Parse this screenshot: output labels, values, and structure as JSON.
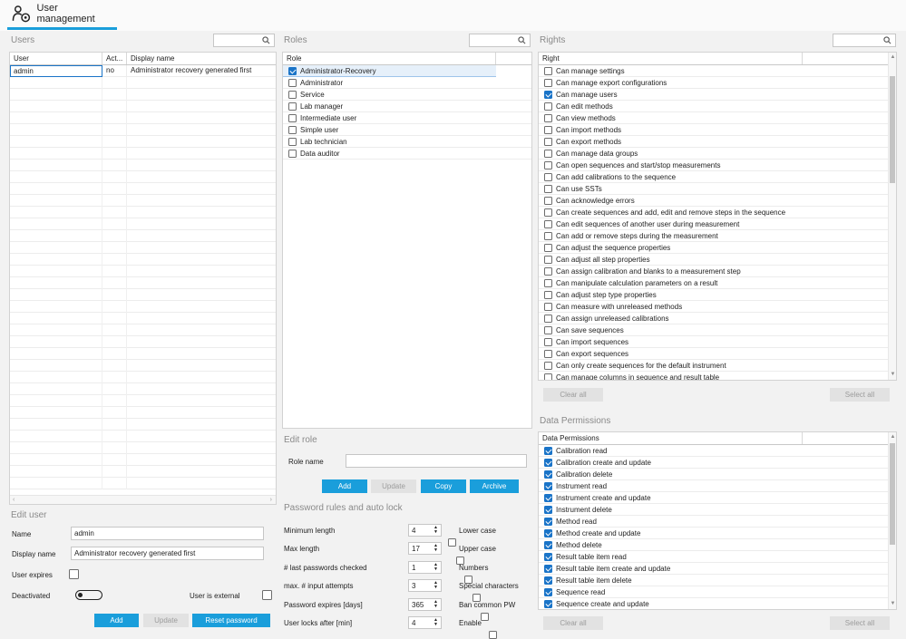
{
  "app": {
    "tab_title": "User management",
    "accent": "#1a9edb"
  },
  "users": {
    "title": "Users",
    "columns": [
      "User",
      "Act...",
      "Display name"
    ],
    "rows": [
      {
        "user": "admin",
        "active": "no",
        "display": "Administrator recovery generated first"
      }
    ]
  },
  "roles": {
    "title": "Roles",
    "column": "Role",
    "items": [
      {
        "label": "Administrator-Recovery",
        "checked": true
      },
      {
        "label": "Administrator",
        "checked": false
      },
      {
        "label": "Service",
        "checked": false
      },
      {
        "label": "Lab manager",
        "checked": false
      },
      {
        "label": "Intermediate user",
        "checked": false
      },
      {
        "label": "Simple user",
        "checked": false
      },
      {
        "label": "Lab technician",
        "checked": false
      },
      {
        "label": "Data auditor",
        "checked": false
      }
    ]
  },
  "rights": {
    "title": "Rights",
    "column": "Right",
    "clear_all": "Clear all",
    "select_all": "Select all",
    "items": [
      {
        "label": "Can manage settings",
        "checked": false
      },
      {
        "label": "Can manage export configurations",
        "checked": false
      },
      {
        "label": "Can manage users",
        "checked": true
      },
      {
        "label": "Can edit methods",
        "checked": false
      },
      {
        "label": "Can view methods",
        "checked": false
      },
      {
        "label": "Can import methods",
        "checked": false
      },
      {
        "label": "Can export methods",
        "checked": false
      },
      {
        "label": "Can manage data groups",
        "checked": false
      },
      {
        "label": "Can open sequences and start/stop measurements",
        "checked": false
      },
      {
        "label": "Can add calibrations to the sequence",
        "checked": false
      },
      {
        "label": "Can use SSTs",
        "checked": false
      },
      {
        "label": "Can acknowledge errors",
        "checked": false
      },
      {
        "label": "Can create sequences and add, edit and remove steps in the sequence",
        "checked": false
      },
      {
        "label": "Can edit sequences of another user during measurement",
        "checked": false
      },
      {
        "label": "Can add or remove steps during the measurement",
        "checked": false
      },
      {
        "label": "Can adjust the sequence properties",
        "checked": false
      },
      {
        "label": "Can adjust all step properties",
        "checked": false
      },
      {
        "label": "Can assign calibration and blanks to a measurement step",
        "checked": false
      },
      {
        "label": "Can manipulate calculation parameters on a result",
        "checked": false
      },
      {
        "label": "Can adjust step type properties",
        "checked": false
      },
      {
        "label": "Can measure with unreleased methods",
        "checked": false
      },
      {
        "label": "Can assign unreleased calibrations",
        "checked": false
      },
      {
        "label": "Can save sequences",
        "checked": false
      },
      {
        "label": "Can import sequences",
        "checked": false
      },
      {
        "label": "Can export sequences",
        "checked": false
      },
      {
        "label": "Can only create sequences for the default instrument",
        "checked": false
      },
      {
        "label": "Can manage columns in sequence and result table",
        "checked": false
      }
    ]
  },
  "data_permissions": {
    "title": "Data Permissions",
    "column": "Data Permissions",
    "clear_all": "Clear all",
    "select_all": "Select all",
    "items": [
      {
        "label": "Calibration read",
        "checked": true
      },
      {
        "label": "Calibration create and update",
        "checked": true
      },
      {
        "label": "Calibration delete",
        "checked": true
      },
      {
        "label": "Instrument read",
        "checked": true
      },
      {
        "label": "Instrument create and update",
        "checked": true
      },
      {
        "label": "Instrument delete",
        "checked": true
      },
      {
        "label": "Method read",
        "checked": true
      },
      {
        "label": "Method create and update",
        "checked": true
      },
      {
        "label": "Method delete",
        "checked": true
      },
      {
        "label": "Result table item read",
        "checked": true
      },
      {
        "label": "Result table item create and update",
        "checked": true
      },
      {
        "label": "Result table item delete",
        "checked": true
      },
      {
        "label": "Sequence read",
        "checked": true
      },
      {
        "label": "Sequence create and update",
        "checked": true
      }
    ]
  },
  "edit_user": {
    "title": "Edit user",
    "name_label": "Name",
    "name_value": "admin",
    "display_label": "Display name",
    "display_value": "Administrator recovery generated first",
    "expires_label": "User expires",
    "deactivated_label": "Deactivated",
    "external_label": "User is external",
    "add": "Add",
    "update": "Update",
    "reset": "Reset password"
  },
  "edit_role": {
    "title": "Edit role",
    "role_name_label": "Role name",
    "role_name_value": "",
    "add": "Add",
    "update": "Update",
    "copy": "Copy",
    "archive": "Archive"
  },
  "password": {
    "title": "Password rules and auto lock",
    "rows": [
      {
        "label": "Minimum length",
        "value": "4",
        "opt": "Lower case"
      },
      {
        "label": "Max length",
        "value": "17",
        "opt": "Upper case"
      },
      {
        "label": "# last passwords checked",
        "value": "1",
        "opt": "Numbers"
      },
      {
        "label": "max. # input attempts",
        "value": "3",
        "opt": "Special characters"
      },
      {
        "label": "Password expires [days]",
        "value": "365",
        "opt": "Ban common PW"
      },
      {
        "label": "User locks after [min]",
        "value": "4",
        "opt": "Enable"
      }
    ]
  }
}
